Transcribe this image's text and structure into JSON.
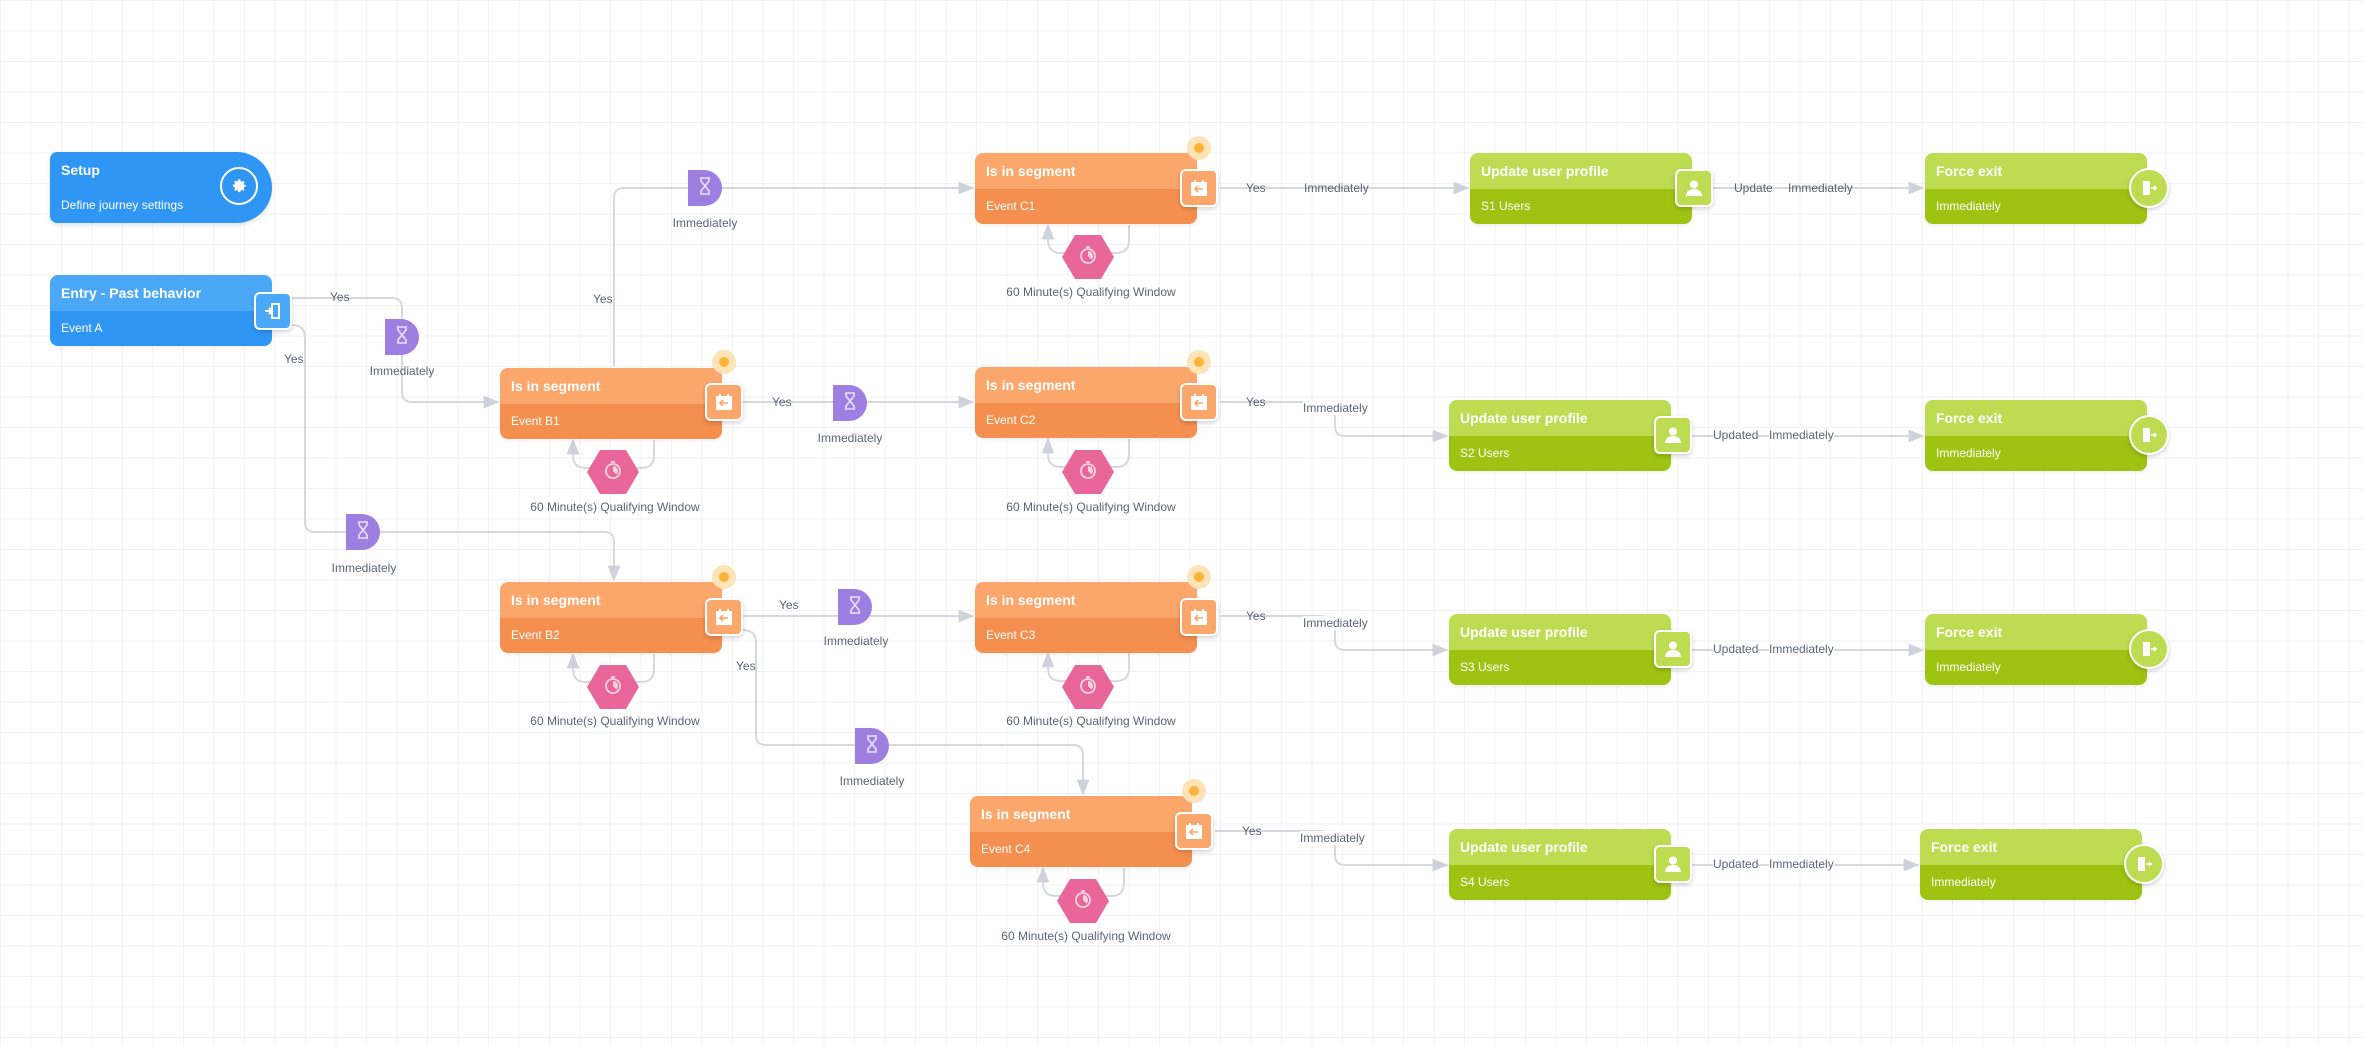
{
  "setup": {
    "title": "Setup",
    "subtitle": "Define journey settings",
    "icon": "gear-icon"
  },
  "entry": {
    "title": "Entry - Past behavior",
    "subtitle": "Event A",
    "icon": "entry-door-icon"
  },
  "segments": [
    {
      "id": "B1",
      "title": "Is in segment",
      "event": "Event B1",
      "window": "60 Minute(s) Qualifying Window"
    },
    {
      "id": "B2",
      "title": "Is in segment",
      "event": "Event B2",
      "window": "60 Minute(s) Qualifying Window"
    },
    {
      "id": "C1",
      "title": "Is in segment",
      "event": "Event C1",
      "window": "60 Minute(s) Qualifying Window"
    },
    {
      "id": "C2",
      "title": "Is in segment",
      "event": "Event C2",
      "window": "60 Minute(s) Qualifying Window"
    },
    {
      "id": "C3",
      "title": "Is in segment",
      "event": "Event C3",
      "window": "60 Minute(s) Qualifying Window"
    },
    {
      "id": "C4",
      "title": "Is in segment",
      "event": "Event C4",
      "window": "60 Minute(s) Qualifying Window"
    }
  ],
  "profiles": [
    {
      "title": "Update user profile",
      "subtitle": "S1 Users",
      "out_label": "Update",
      "delay": "Immediately"
    },
    {
      "title": "Update user profile",
      "subtitle": "S2 Users",
      "out_label": "Updated",
      "delay": "Immediately"
    },
    {
      "title": "Update user profile",
      "subtitle": "S3 Users",
      "out_label": "Updated",
      "delay": "Immediately"
    },
    {
      "title": "Update user profile",
      "subtitle": "S4 Users",
      "out_label": "Updated",
      "delay": "Immediately"
    }
  ],
  "exits": [
    {
      "title": "Force exit",
      "subtitle": "Immediately"
    },
    {
      "title": "Force exit",
      "subtitle": "Immediately"
    },
    {
      "title": "Force exit",
      "subtitle": "Immediately"
    },
    {
      "title": "Force exit",
      "subtitle": "Immediately"
    }
  ],
  "edges": {
    "yes": "Yes",
    "immediately": "Immediately"
  },
  "colors": {
    "entry_blue": "#2f96f3",
    "segment_orange": "#f48f4f",
    "profile_green": "#9fc312",
    "delay_purple": "#9c7fe0",
    "window_pink": "#e8669a",
    "connector_gray": "#d3d5dc"
  }
}
